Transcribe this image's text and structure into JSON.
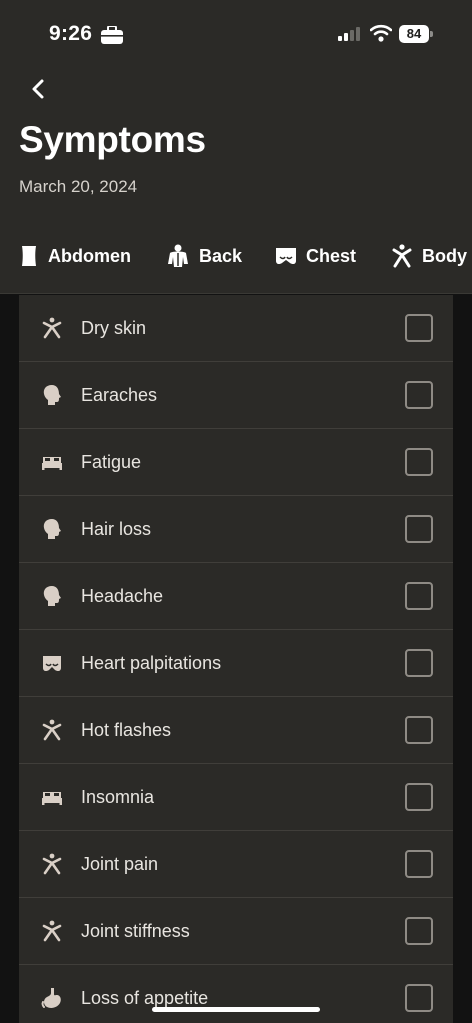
{
  "status_bar": {
    "time": "9:26",
    "battery": "84"
  },
  "header": {
    "title": "Symptoms",
    "date": "March 20, 2024"
  },
  "categories": [
    {
      "label": "Abdomen",
      "icon": "abdomen-icon"
    },
    {
      "label": "Back",
      "icon": "back-body-icon"
    },
    {
      "label": "Chest",
      "icon": "chest-icon"
    },
    {
      "label": "Body",
      "icon": "body-icon"
    }
  ],
  "symptoms": [
    {
      "label": "Dry skin",
      "icon": "body-icon",
      "checked": false
    },
    {
      "label": "Earaches",
      "icon": "head-icon",
      "checked": false
    },
    {
      "label": "Fatigue",
      "icon": "bed-icon",
      "checked": false
    },
    {
      "label": "Hair loss",
      "icon": "head-icon",
      "checked": false
    },
    {
      "label": "Headache",
      "icon": "head-icon",
      "checked": false
    },
    {
      "label": "Heart palpitations",
      "icon": "chest-icon",
      "checked": false
    },
    {
      "label": "Hot flashes",
      "icon": "body-icon",
      "checked": false
    },
    {
      "label": "Insomnia",
      "icon": "bed-icon",
      "checked": false
    },
    {
      "label": "Joint pain",
      "icon": "body-icon",
      "checked": false
    },
    {
      "label": "Joint stiffness",
      "icon": "body-icon",
      "checked": false
    },
    {
      "label": "Loss of appetite",
      "icon": "stomach-icon",
      "checked": false
    }
  ],
  "colors": {
    "header_bg": "#2b2a27",
    "list_bg": "#2b2a27",
    "page_bg": "#121212",
    "icon": "#d9cfc6",
    "text": "#ffffff"
  }
}
